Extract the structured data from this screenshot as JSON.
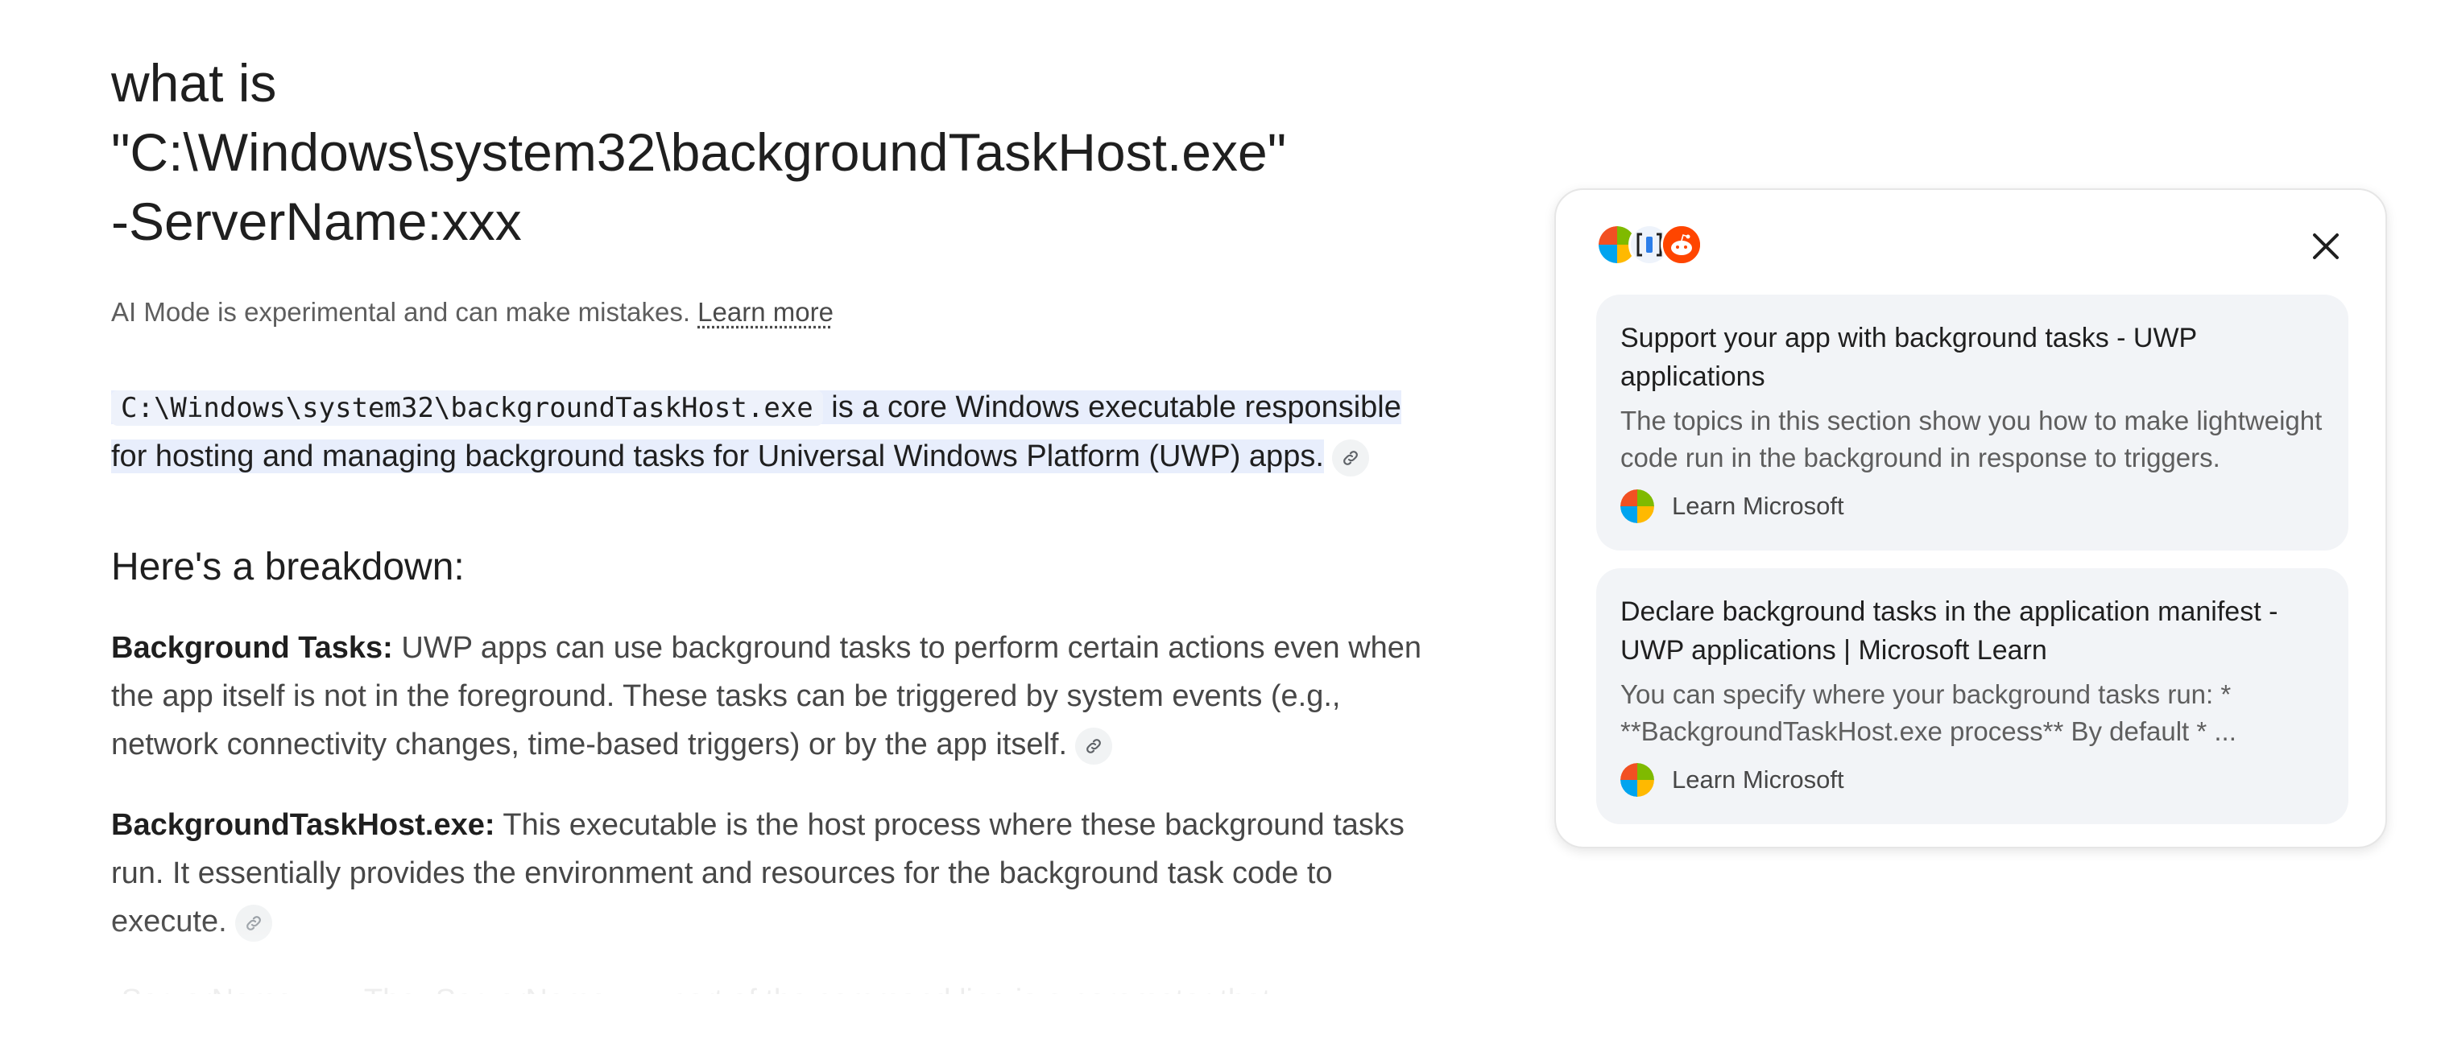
{
  "query": {
    "title": "what is\n\"C:\\Windows\\system32\\backgroundTaskHost.exe\"\n-ServerName:xxx"
  },
  "disclaimer": {
    "text": "AI Mode is experimental and can make mistakes. ",
    "learn_more": "Learn more"
  },
  "answer": {
    "code": "C:\\Windows\\system32\\backgroundTaskHost.exe",
    "intro_text": " is a core Windows executable responsible for hosting and managing background tasks for Universal Windows Platform (UWP) apps.",
    "breakdown_heading": "Here's a breakdown:",
    "items": [
      {
        "term": "Background Tasks:",
        "text": " UWP apps can use background tasks to perform certain actions even when the app itself is not in the foreground. These tasks can be triggered by system events (e.g., network connectivity changes, time-based triggers) or by the app itself."
      },
      {
        "term": "BackgroundTaskHost.exe:",
        "text": " This executable is the host process where these background tasks run. It essentially provides the environment and resources for the background task code to execute."
      }
    ],
    "cut_off_line": "-ServerName:xxx: The -ServerName:xxx part of the command line is a parameter that"
  },
  "sources": {
    "close_icon": "close-icon",
    "cards": [
      {
        "title": "Support your app with background tasks - UWP applications",
        "snippet": "The topics in this section show you how to make lightweight code run in the background in response to triggers.",
        "source": "Learn Microsoft"
      },
      {
        "title": "Declare background tasks in the application manifest - UWP applications | Microsoft Learn",
        "snippet": "You can specify where your background tasks run: * **BackgroundTaskHost.exe process** By default * ...",
        "source": "Learn Microsoft"
      }
    ]
  },
  "colors": {
    "highlight": "#e8eefc",
    "card_bg": "#f2f4f7",
    "ms_red": "#f25022",
    "ms_green": "#7fba00",
    "ms_blue": "#00a4ef",
    "ms_yellow": "#ffb900",
    "reddit": "#ff4500"
  }
}
